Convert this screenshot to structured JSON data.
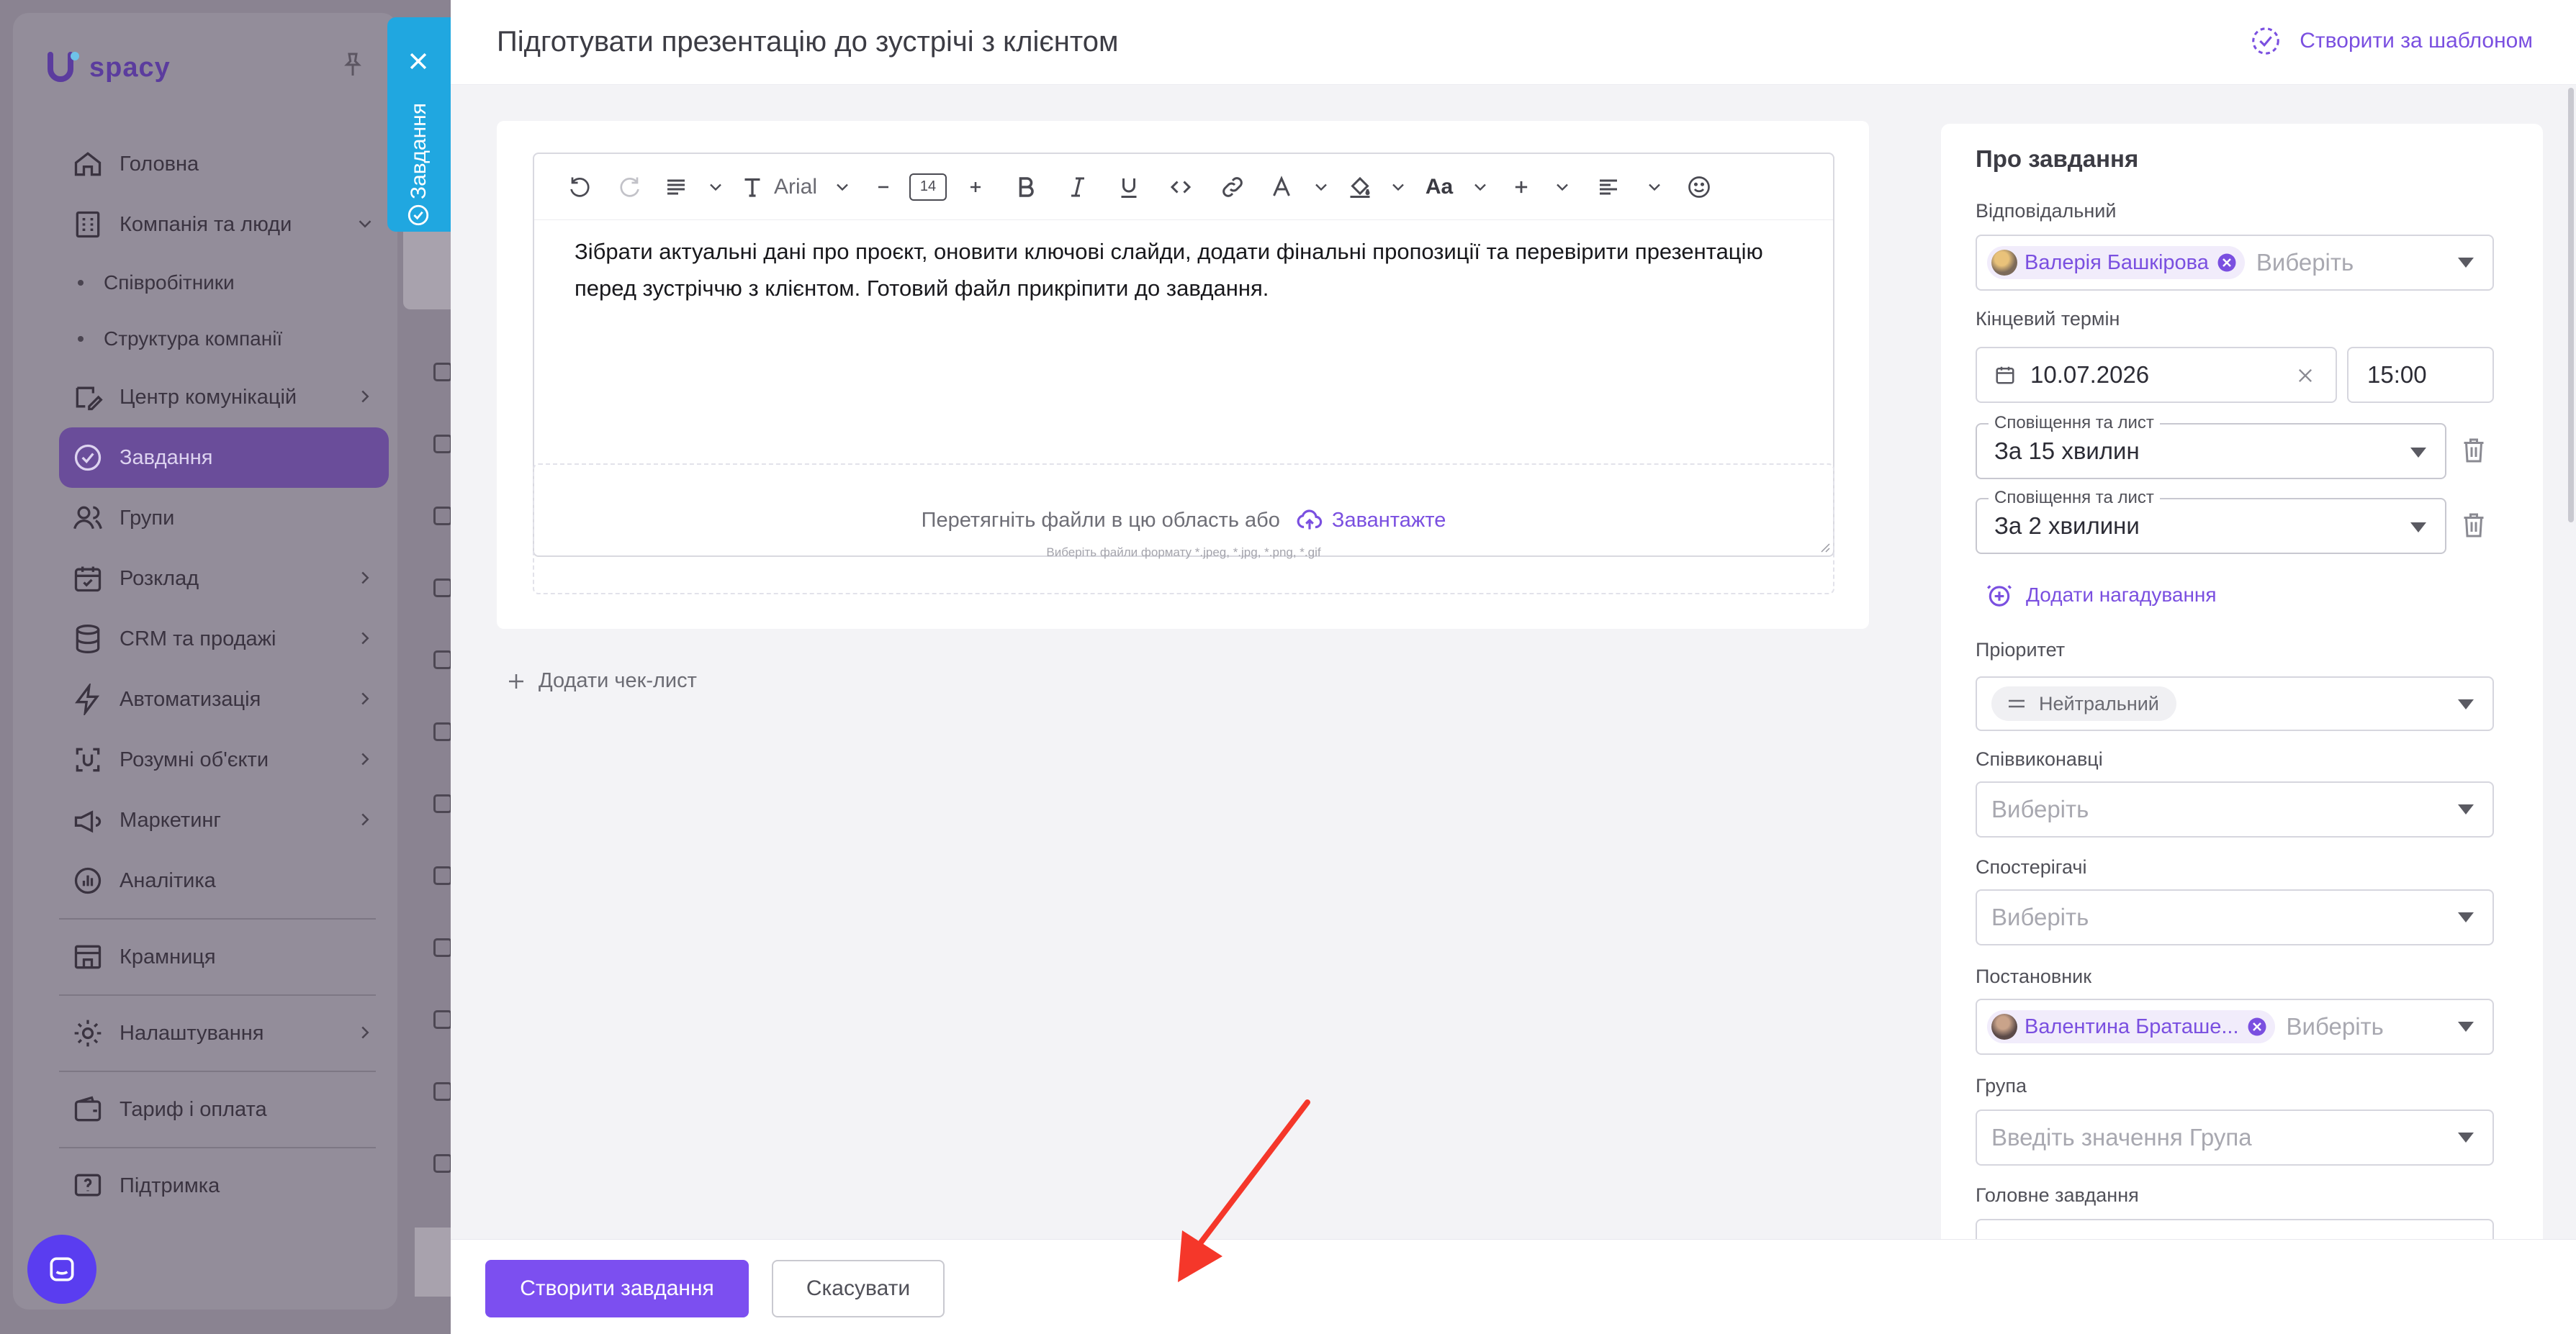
{
  "app": {
    "logo_text": "spacy"
  },
  "sidebar": {
    "items": [
      {
        "label": "Головна",
        "icon": "home-icon"
      },
      {
        "label": "Компанія та люди",
        "icon": "company-icon",
        "expanded": true
      },
      {
        "label": "Співробітники"
      },
      {
        "label": "Структура компанії"
      },
      {
        "label": "Центр комунікацій",
        "icon": "chat-edit-icon"
      },
      {
        "label": "Завдання",
        "icon": "task-check-icon",
        "active": true
      },
      {
        "label": "Групи",
        "icon": "groups-icon"
      },
      {
        "label": "Розклад",
        "icon": "calendar-icon"
      },
      {
        "label": "CRM та продажі",
        "icon": "database-icon"
      },
      {
        "label": "Автоматизація",
        "icon": "bolt-icon"
      },
      {
        "label": "Розумні об'єкти",
        "icon": "smart-objects-icon"
      },
      {
        "label": "Маркетинг",
        "icon": "megaphone-icon"
      },
      {
        "label": "Аналітика",
        "icon": "analytics-icon"
      },
      {
        "label": "Крамниця",
        "icon": "store-icon"
      },
      {
        "label": "Налаштування",
        "icon": "gear-icon"
      },
      {
        "label": "Тариф і оплата",
        "icon": "wallet-icon"
      },
      {
        "label": "Підтримка",
        "icon": "support-icon"
      }
    ]
  },
  "side_tab": {
    "label": "Завдання"
  },
  "task": {
    "title": "Підготувати презентацію до зустрічі з клієнтом",
    "template_label": "Створити за шаблоном",
    "description": "Зібрати актуальні дані про проєкт, оновити ключові слайди, додати фінальні пропозиції та перевірити презентацію перед зустріччю з клієнтом. Готовий файл прикріпити до завдання.",
    "editor": {
      "font": "Arial",
      "font_size": "14",
      "case_label": "Aa"
    },
    "dropzone": {
      "text": "Перетягніть файли в цю область або",
      "upload_label": "Завантажте",
      "hint": "Виберіть файли формату *.jpeg, *.jpg, *.png, *.gif"
    },
    "add_checklist": "Додати чек-лист"
  },
  "panel": {
    "title": "Про завдання",
    "responsible": {
      "label": "Відповідальний",
      "chip": "Валерія Башкірова",
      "placeholder": "Виберіть"
    },
    "deadline": {
      "label": "Кінцевий термін",
      "date": "10.07.2026",
      "time": "15:00"
    },
    "reminders": [
      {
        "legend": "Сповіщення та лист",
        "value": "За 15 хвилин"
      },
      {
        "legend": "Сповіщення та лист",
        "value": "За 2 хвилини"
      }
    ],
    "add_reminder": "Додати нагадування",
    "priority": {
      "label": "Пріоритет",
      "value": "Нейтральний"
    },
    "coexecutors": {
      "label": "Співвиконавці",
      "placeholder": "Виберіть"
    },
    "observers": {
      "label": "Спостерігачі",
      "placeholder": "Виберіть"
    },
    "creator": {
      "label": "Постановник",
      "chip": "Валентина Браташе...",
      "placeholder": "Виберіть"
    },
    "group": {
      "label": "Група",
      "placeholder": "Введіть значення Група"
    },
    "parent": {
      "label": "Головне завдання"
    }
  },
  "footer": {
    "create_label": "Створити завдання",
    "cancel_label": "Скасувати"
  },
  "colors": {
    "accent": "#7c4ff0",
    "tab": "#20a7e0",
    "annotation_arrow": "#f5372a"
  }
}
